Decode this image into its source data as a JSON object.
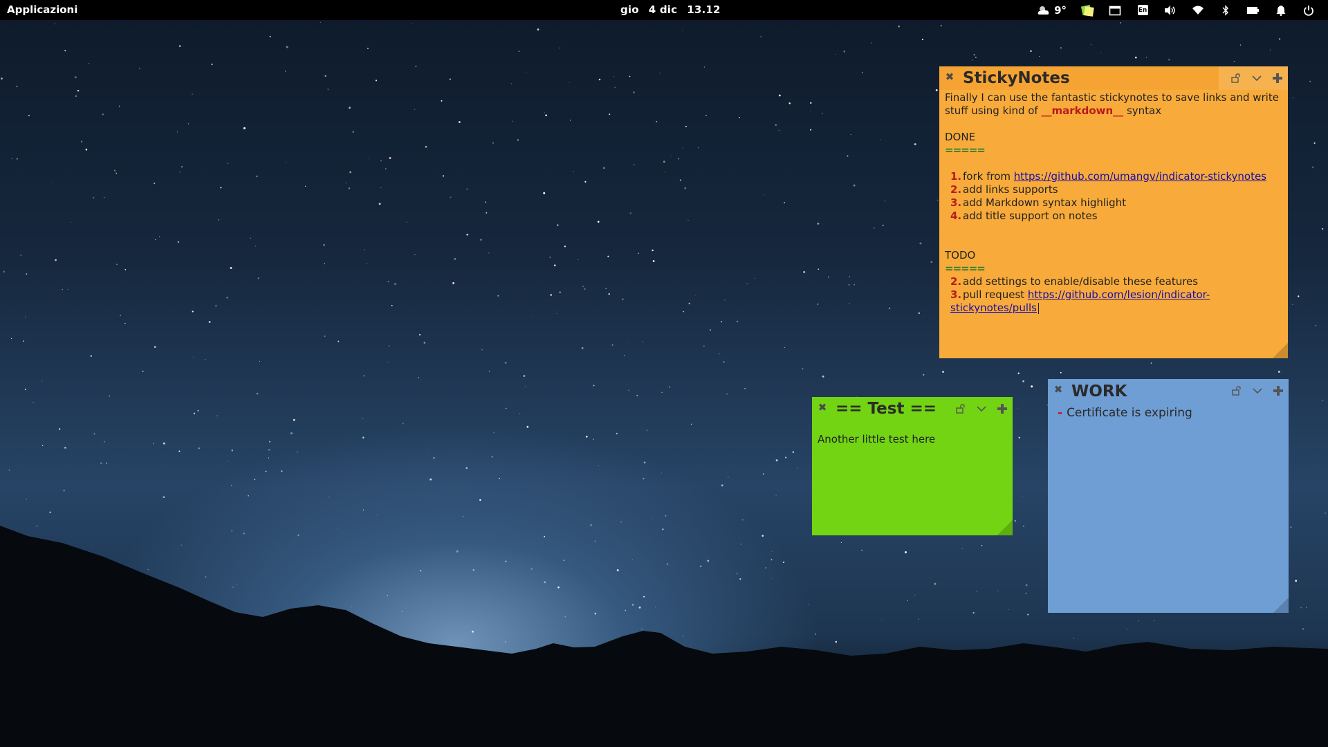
{
  "panel": {
    "apps_label": "Applicazioni",
    "clock_day": "gio",
    "clock_date": "4 dic",
    "clock_time": "13.12",
    "weather_temp": "9°",
    "keyboard_layout": "En",
    "tray_icons": [
      "weather-icon",
      "stickynotes-icon",
      "window-icon",
      "keyboard-layout-icon",
      "volume-icon",
      "wifi-icon",
      "bluetooth-icon",
      "battery-icon",
      "notification-bell-icon",
      "power-icon"
    ]
  },
  "notes": {
    "sticky": {
      "title": "StickyNotes",
      "intro_a": "Finally I can use the fantastic stickynotes to save links and write stuff using kind of ",
      "intro_bold": "__markdown__",
      "intro_b": " syntax",
      "done_heading": "DONE",
      "done_rule": "=====",
      "done_items": [
        {
          "num": "1.",
          "text": "fork from ",
          "link": "https://github.com/umangv/indicator-stickynotes"
        },
        {
          "num": "2.",
          "text": "add links supports",
          "link": ""
        },
        {
          "num": "3.",
          "text": "add Markdown syntax highlight",
          "link": ""
        },
        {
          "num": "4.",
          "text": "add title support on notes",
          "link": ""
        }
      ],
      "todo_heading": "TODO",
      "todo_rule": "=====",
      "todo_items": [
        {
          "num": "2.",
          "text": "add settings to enable/disable these features",
          "link": ""
        },
        {
          "num": "3.",
          "text": "pull request ",
          "link": "https://github.com/lesion/indicator-stickynotes/pulls"
        }
      ],
      "color": "#f8ab3a"
    },
    "test": {
      "title": "== Test ==",
      "text": "Another little test here",
      "color": "#72d412"
    },
    "work": {
      "title": "WORK",
      "bullet": "-",
      "item": "Certificate is expiring",
      "color": "#6f9ed4"
    }
  }
}
